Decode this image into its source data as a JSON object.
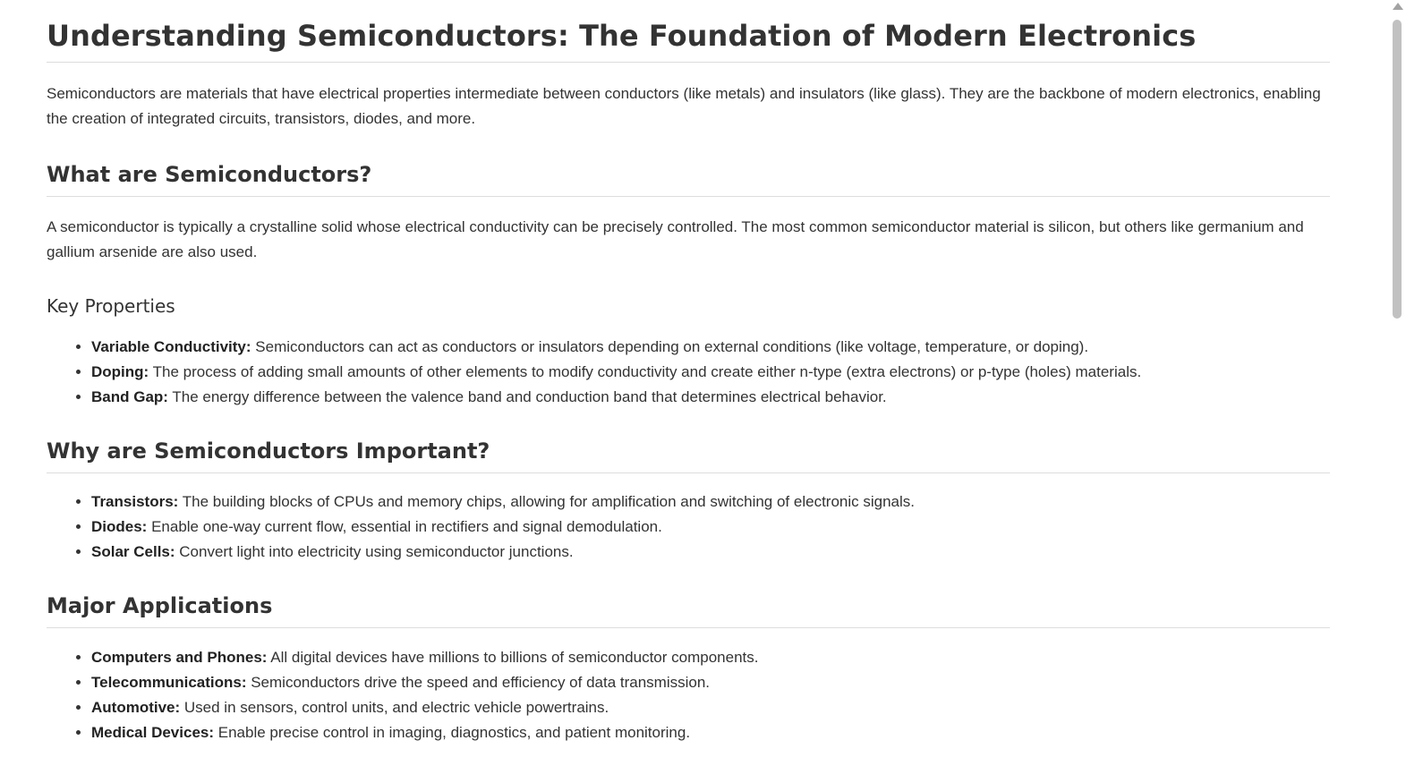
{
  "title": "Understanding Semiconductors: The Foundation of Modern Electronics",
  "intro": "Semiconductors are materials that have electrical properties intermediate between conductors (like metals) and insulators (like glass). They are the backbone of modern electronics, enabling the creation of integrated circuits, transistors, diodes, and more.",
  "sections": [
    {
      "heading": "What are Semiconductors?",
      "paragraph": "A semiconductor is typically a crystalline solid whose electrical conductivity can be precisely controlled. The most common semiconductor material is silicon, but others like germanium and gallium arsenide are also used.",
      "subheading": "Key Properties",
      "items": [
        {
          "term": "Variable Conductivity:",
          "text": " Semiconductors can act as conductors or insulators depending on external conditions (like voltage, temperature, or doping)."
        },
        {
          "term": "Doping:",
          "text": " The process of adding small amounts of other elements to modify conductivity and create either n-type (extra electrons) or p-type (holes) materials."
        },
        {
          "term": "Band Gap:",
          "text": " The energy difference between the valence band and conduction band that determines electrical behavior."
        }
      ]
    },
    {
      "heading": "Why are Semiconductors Important?",
      "items": [
        {
          "term": "Transistors:",
          "text": " The building blocks of CPUs and memory chips, allowing for amplification and switching of electronic signals."
        },
        {
          "term": "Diodes:",
          "text": " Enable one-way current flow, essential in rectifiers and signal demodulation."
        },
        {
          "term": "Solar Cells:",
          "text": " Convert light into electricity using semiconductor junctions."
        }
      ]
    },
    {
      "heading": "Major Applications",
      "items": [
        {
          "term": "Computers and Phones:",
          "text": " All digital devices have millions to billions of semiconductor components."
        },
        {
          "term": "Telecommunications:",
          "text": " Semiconductors drive the speed and efficiency of data transmission."
        },
        {
          "term": "Automotive:",
          "text": " Used in sensors, control units, and electric vehicle powertrains."
        },
        {
          "term": "Medical Devices:",
          "text": " Enable precise control in imaging, diagnostics, and patient monitoring."
        }
      ]
    }
  ]
}
